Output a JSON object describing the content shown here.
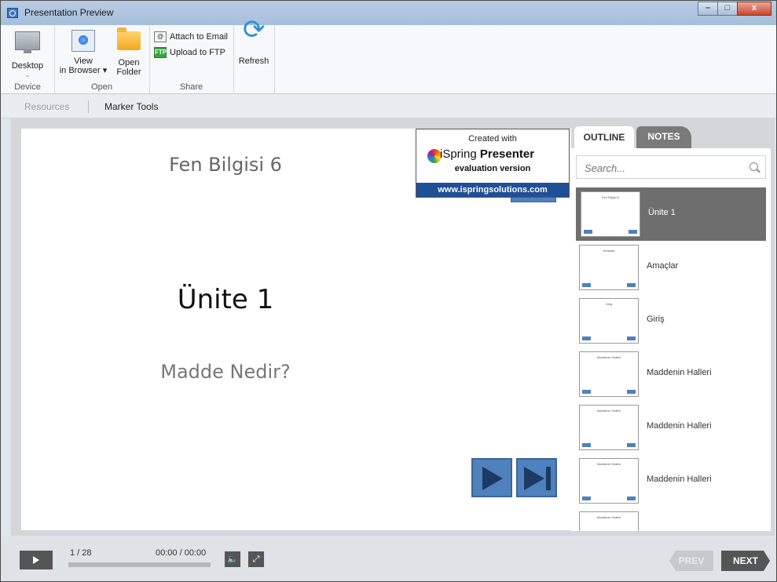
{
  "window": {
    "title": "Presentation Preview",
    "min_glyph": "–",
    "max_glyph": "□",
    "close_glyph": "x"
  },
  "ribbon": {
    "device": {
      "desktop_label": "Desktop",
      "group_label": "Device"
    },
    "open": {
      "view_label_1": "View",
      "view_label_2": "in Browser ▾",
      "folder_label_1": "Open",
      "folder_label_2": "Folder",
      "group_label": "Open"
    },
    "share": {
      "attach_label": "Attach to Email",
      "ftp_label": "Upload to FTP",
      "ftp_icon_text": "FTP",
      "group_label": "Share"
    },
    "refresh_label": "Refresh"
  },
  "toolbar": {
    "resources": "Resources",
    "marker_tools": "Marker Tools"
  },
  "slide": {
    "subject": "Fen Bilgisi 6",
    "title": "Ünite 1",
    "subtitle": "Madde Nedir?"
  },
  "watermark": {
    "line1": "Created with",
    "brand_normal": "iSpring ",
    "brand_bold": "Presenter",
    "line3": "evaluation version",
    "url": "www.ispringsolutions.com"
  },
  "panel": {
    "tab_outline": "OUTLINE",
    "tab_notes": "NOTES",
    "search_placeholder": "Search...",
    "items": [
      {
        "label": "Ünite 1",
        "thumb_title": "Fen Bilgisi 6"
      },
      {
        "label": "Amaçlar",
        "thumb_title": "Amaçlar"
      },
      {
        "label": "Giriş",
        "thumb_title": "Giriş"
      },
      {
        "label": "Maddenin Halleri",
        "thumb_title": "Maddenin Halleri"
      },
      {
        "label": "Maddenin Halleri",
        "thumb_title": "Maddenin Halleri"
      },
      {
        "label": "Maddenin Halleri",
        "thumb_title": "Maddenin Halleri"
      },
      {
        "label": "",
        "thumb_title": "Maddenin Halleri"
      }
    ]
  },
  "player": {
    "slide_count": "1 / 28",
    "time": "00:00 / 00:00",
    "progress": 0,
    "volume_glyph": "🔈",
    "fullscreen_glyph": "⤢",
    "prev_label": "PREV",
    "next_label": "NEXT"
  },
  "colors": {
    "accent": "#4f81bd",
    "selected_item": "#6e6e6e",
    "watermark_bar": "#1f4f96"
  }
}
